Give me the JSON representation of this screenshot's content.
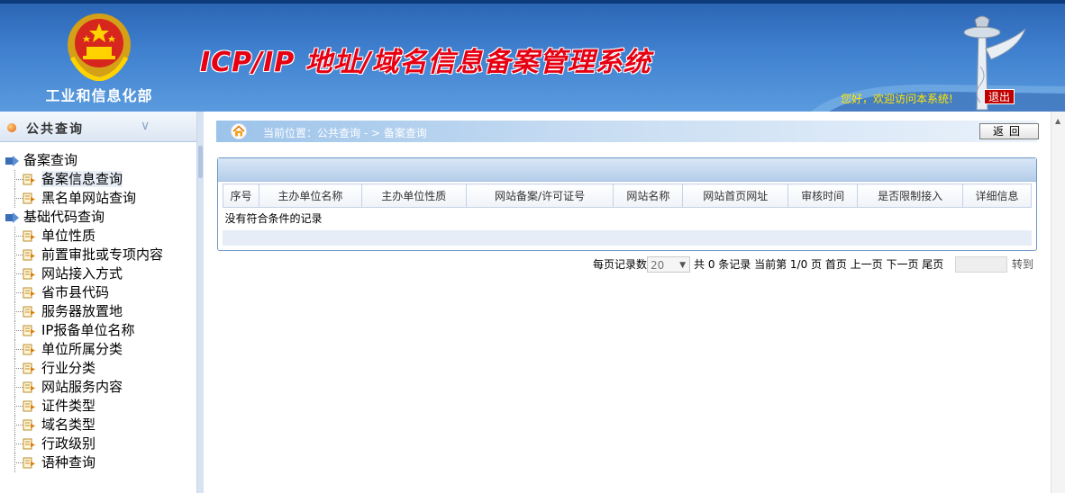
{
  "header": {
    "ministry": "工业和信息化部",
    "title": "ICP/IP 地址/域名信息备案管理系统",
    "welcome": "您好，欢迎访问本系统!",
    "logout_label": "退出",
    "colors": {
      "title": "#e60012",
      "welcome": "#ffe600",
      "logout_bg": "#c00000"
    }
  },
  "sidebar": {
    "heading": "公共查询",
    "groups": [
      {
        "label": "备案查询",
        "items": [
          "备案信息查询",
          "黑名单网站查询"
        ]
      },
      {
        "label": "基础代码查询",
        "items": [
          "单位性质",
          "前置审批或专项内容",
          "网站接入方式",
          "省市县代码",
          "服务器放置地",
          "IP报备单位名称",
          "单位所属分类",
          "行业分类",
          "网站服务内容",
          "证件类型",
          "域名类型",
          "行政级别",
          "语种查询"
        ]
      }
    ],
    "selected": "备案信息查询"
  },
  "breadcrumb": {
    "text": "当前位置：公共查询  - >  备案查询",
    "back_label": "返回"
  },
  "table": {
    "columns": [
      "序号",
      "主办单位名称",
      "主办单位性质",
      "网站备案/许可证号",
      "网站名称",
      "网站首页网址",
      "审核时间",
      "是否限制接入",
      "详细信息"
    ],
    "empty_message": "没有符合条件的记录"
  },
  "pager": {
    "per_page_label": "每页记录数",
    "per_page_value": "20",
    "summary": "共 0 条记录  当前第 1/0 页 首页 上一页 下一页 尾页",
    "goto_label": "转到"
  }
}
